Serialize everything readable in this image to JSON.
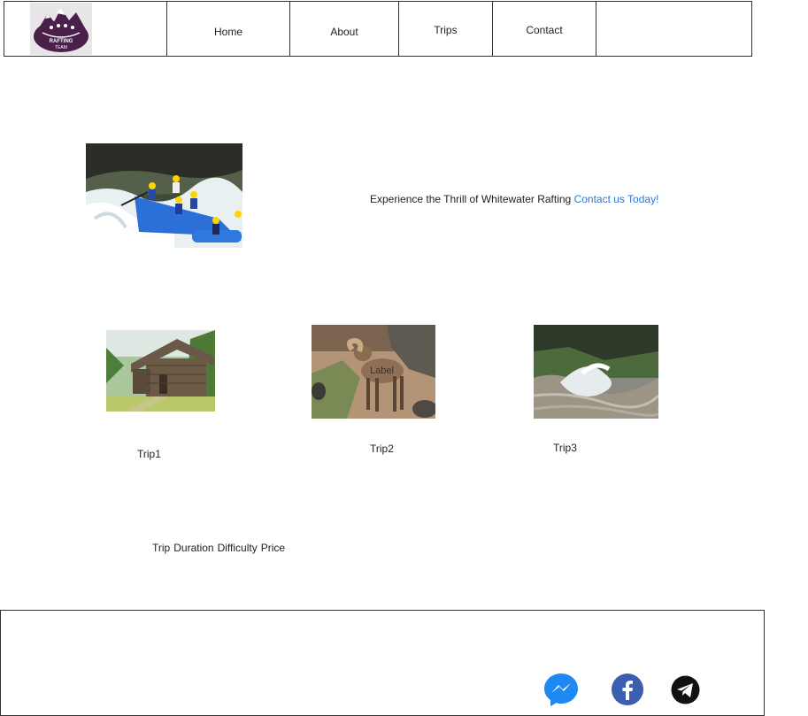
{
  "nav": {
    "logo_text": [
      "RAFTING",
      "TEAM"
    ],
    "items": [
      {
        "label": "Home"
      },
      {
        "label": "About"
      },
      {
        "label": "Trips"
      },
      {
        "label": "Contact"
      }
    ]
  },
  "hero": {
    "headline": "Experience the Thrill of Whitewater Rafting",
    "cta_link": "Contact us Today!"
  },
  "trips": {
    "image_label": "Label",
    "items": [
      {
        "label": "Trip1"
      },
      {
        "label": "Trip2"
      },
      {
        "label": "Trip3"
      }
    ],
    "table_headers": [
      "Trip",
      "Duration",
      "Difficulty",
      "Price"
    ]
  },
  "footer": {
    "social_icons": [
      "messenger-icon",
      "facebook-icon",
      "telegram-icon"
    ]
  },
  "colors": {
    "link": "#2a78d4",
    "logo": "#4a1f4a",
    "messenger": "#1e88f5",
    "facebook": "#3b5fae",
    "telegram": "#111111"
  }
}
